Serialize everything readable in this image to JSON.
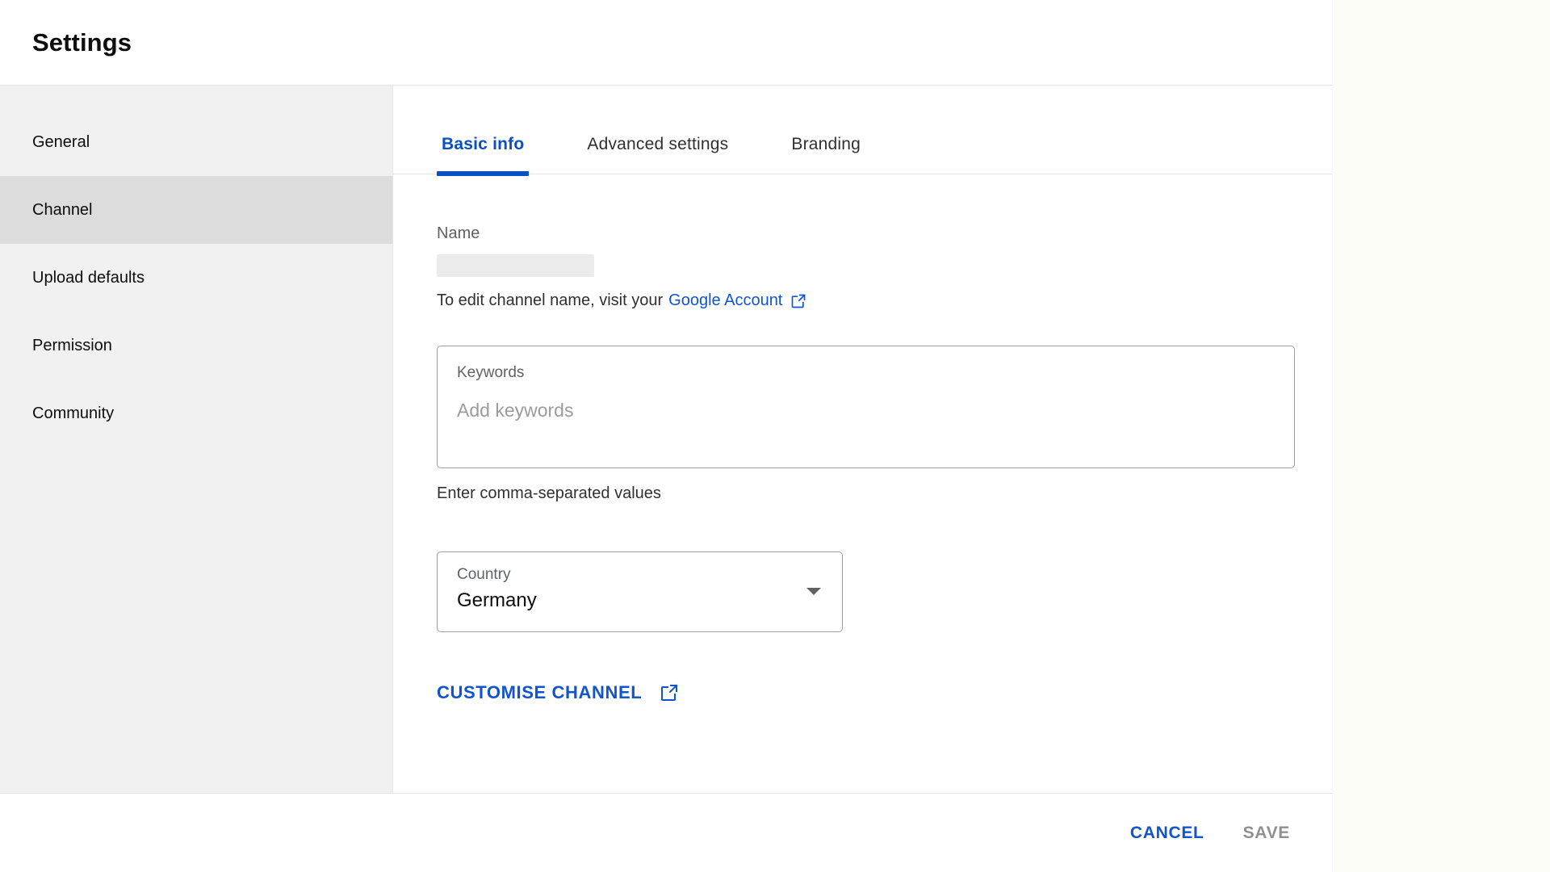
{
  "window": {
    "title": "Settings",
    "background_color": "#fdfdf8"
  },
  "sidebar": {
    "items": [
      {
        "label": "General",
        "active": false
      },
      {
        "label": "Channel",
        "active": true
      },
      {
        "label": "Upload defaults",
        "active": false
      },
      {
        "label": "Permission",
        "active": false
      },
      {
        "label": "Community",
        "active": false
      }
    ]
  },
  "tabs": [
    {
      "label": "Basic info",
      "active": true
    },
    {
      "label": "Advanced settings",
      "active": false
    },
    {
      "label": "Branding",
      "active": false
    }
  ],
  "form": {
    "name": {
      "label": "Name",
      "value": "",
      "redacted": true
    },
    "name_helper": {
      "text": "To edit channel name, visit your",
      "link_label": "Google Account",
      "link_icon": "external-link-icon"
    },
    "keywords": {
      "label": "Keywords",
      "placeholder": "Add keywords",
      "value": "",
      "hint": "Enter comma-separated values"
    },
    "country": {
      "label": "Country",
      "value": "Germany",
      "caret_icon": "chevron-down-icon"
    },
    "customise_channel": {
      "label": "CUSTOMISE CHANNEL",
      "icon": "external-link-icon"
    }
  },
  "footer": {
    "cancel_label": "CANCEL",
    "save_label": "SAVE"
  },
  "colors": {
    "accent_blue": "#1155cc",
    "tab_active_blue": "#0b4fc4",
    "sidebar_bg": "#f1f1f1",
    "sidebar_active_bg": "#dcdcdc",
    "disabled_gray": "#909090"
  }
}
